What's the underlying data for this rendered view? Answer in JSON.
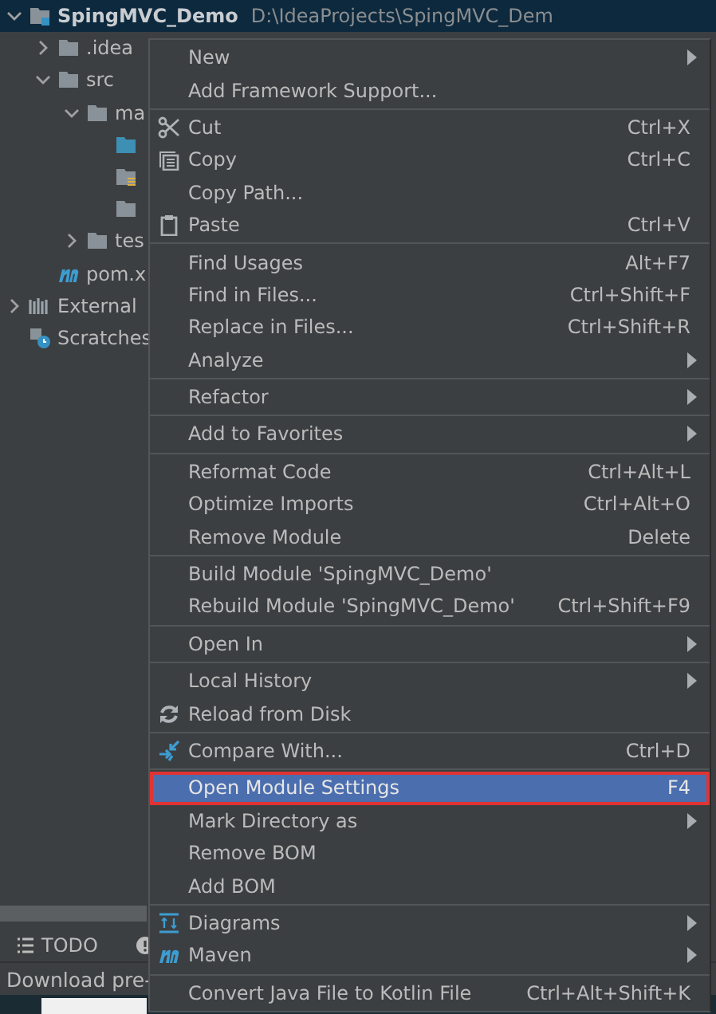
{
  "project_tree": {
    "root": {
      "label": "SpingMVC_Demo",
      "path": "D:\\IdeaProjects\\SpingMVC_Dem",
      "expanded": true,
      "selected": true
    },
    "items": [
      {
        "label": ".idea",
        "kind": "folder",
        "expanded": false
      },
      {
        "label": "src",
        "kind": "folder",
        "expanded": true,
        "children": [
          {
            "label": "ma",
            "kind": "folder",
            "expanded": true,
            "children": [
              {
                "kind": "source-folder"
              },
              {
                "kind": "resource-folder"
              },
              {
                "kind": "folder"
              }
            ]
          },
          {
            "label": "tes",
            "kind": "folder",
            "expanded": false
          }
        ]
      },
      {
        "label": "pom.x",
        "kind": "maven"
      }
    ],
    "extra": [
      {
        "label": "External",
        "kind": "libraries",
        "expanded": false
      },
      {
        "label": "Scratches",
        "kind": "scratches"
      }
    ]
  },
  "context_menu": {
    "groups": [
      [
        {
          "label": "New",
          "submenu": true,
          "selected": false
        },
        {
          "label": "Add Framework Support...",
          "selected": false
        }
      ],
      [
        {
          "label": "Cut",
          "kind": "scissors",
          "shortcut": "Ctrl+X",
          "selected": false
        },
        {
          "label": "Copy",
          "kind": "copy",
          "shortcut": "Ctrl+C",
          "selected": false
        },
        {
          "label": "Copy Path...",
          "selected": false
        },
        {
          "label": "Paste",
          "kind": "clipboard",
          "shortcut": "Ctrl+V",
          "selected": false
        }
      ],
      [
        {
          "label": "Find Usages",
          "shortcut": "Alt+F7",
          "selected": false
        },
        {
          "label": "Find in Files...",
          "shortcut": "Ctrl+Shift+F",
          "selected": false
        },
        {
          "label": "Replace in Files...",
          "shortcut": "Ctrl+Shift+R",
          "selected": false
        },
        {
          "label": "Analyze",
          "submenu": true,
          "selected": false
        }
      ],
      [
        {
          "label": "Refactor",
          "submenu": true,
          "selected": false
        }
      ],
      [
        {
          "label": "Add to Favorites",
          "submenu": true,
          "selected": false
        }
      ],
      [
        {
          "label": "Reformat Code",
          "shortcut": "Ctrl+Alt+L",
          "selected": false
        },
        {
          "label": "Optimize Imports",
          "shortcut": "Ctrl+Alt+O",
          "selected": false
        },
        {
          "label": "Remove Module",
          "shortcut": "Delete",
          "selected": false
        }
      ],
      [
        {
          "label": "Build Module 'SpingMVC_Demo'",
          "selected": false
        },
        {
          "label": "Rebuild Module 'SpingMVC_Demo'",
          "shortcut": "Ctrl+Shift+F9",
          "selected": false
        }
      ],
      [
        {
          "label": "Open In",
          "submenu": true,
          "selected": false
        }
      ],
      [
        {
          "label": "Local History",
          "submenu": true,
          "selected": false
        },
        {
          "label": "Reload from Disk",
          "kind": "reload",
          "selected": false
        }
      ],
      [
        {
          "label": "Compare With...",
          "kind": "compare",
          "shortcut": "Ctrl+D",
          "selected": false
        }
      ],
      [
        {
          "label": "Open Module Settings",
          "shortcut": "F4",
          "selected": true
        },
        {
          "label": "Mark Directory as",
          "submenu": true,
          "selected": false
        },
        {
          "label": "Remove BOM",
          "selected": false
        },
        {
          "label": "Add BOM",
          "selected": false
        }
      ],
      [
        {
          "label": "Diagrams",
          "kind": "diagram",
          "submenu": true,
          "selected": false
        },
        {
          "label": "Maven",
          "kind": "maven",
          "submenu": true,
          "selected": false
        }
      ],
      [
        {
          "label": "Convert Java File to Kotlin File",
          "shortcut": "Ctrl+Alt+Shift+K",
          "selected": false
        }
      ]
    ]
  },
  "tool_window_bar": {
    "tabs": [
      {
        "label": "TODO",
        "selected": false
      }
    ]
  },
  "status_bar": {
    "text": "Download pre-"
  }
}
